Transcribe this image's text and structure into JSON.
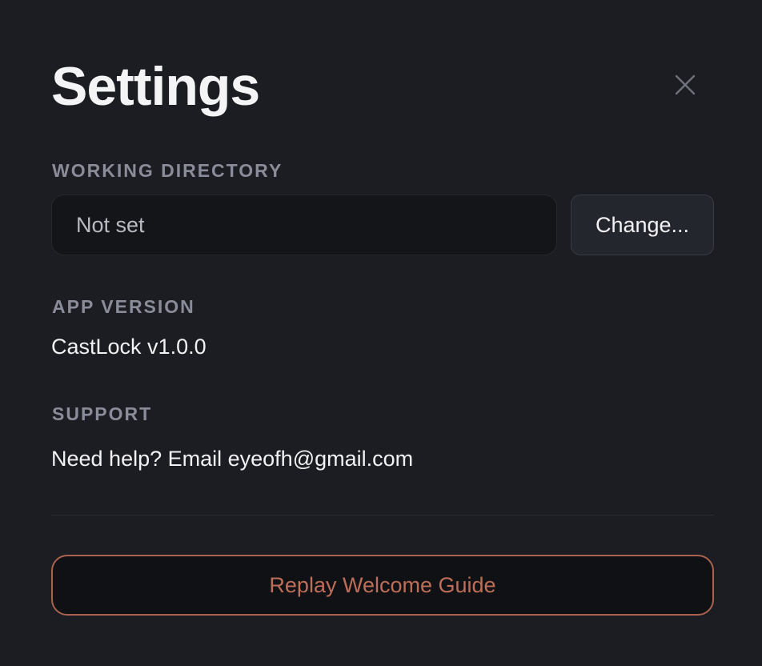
{
  "dialog": {
    "title": "Settings",
    "close_icon": "close-icon"
  },
  "working_directory": {
    "label": "WORKING DIRECTORY",
    "value": "Not set",
    "change_label": "Change..."
  },
  "app_version": {
    "label": "APP VERSION",
    "value": "CastLock v1.0.0"
  },
  "support": {
    "label": "SUPPORT",
    "text": "Need help? Email eyeofh@gmail.com"
  },
  "replay_button": {
    "label": "Replay Welcome Guide"
  },
  "colors": {
    "background": "#1c1d22",
    "field_background": "#141519",
    "accent": "#bd6e58",
    "label_muted": "#8a8d99"
  }
}
